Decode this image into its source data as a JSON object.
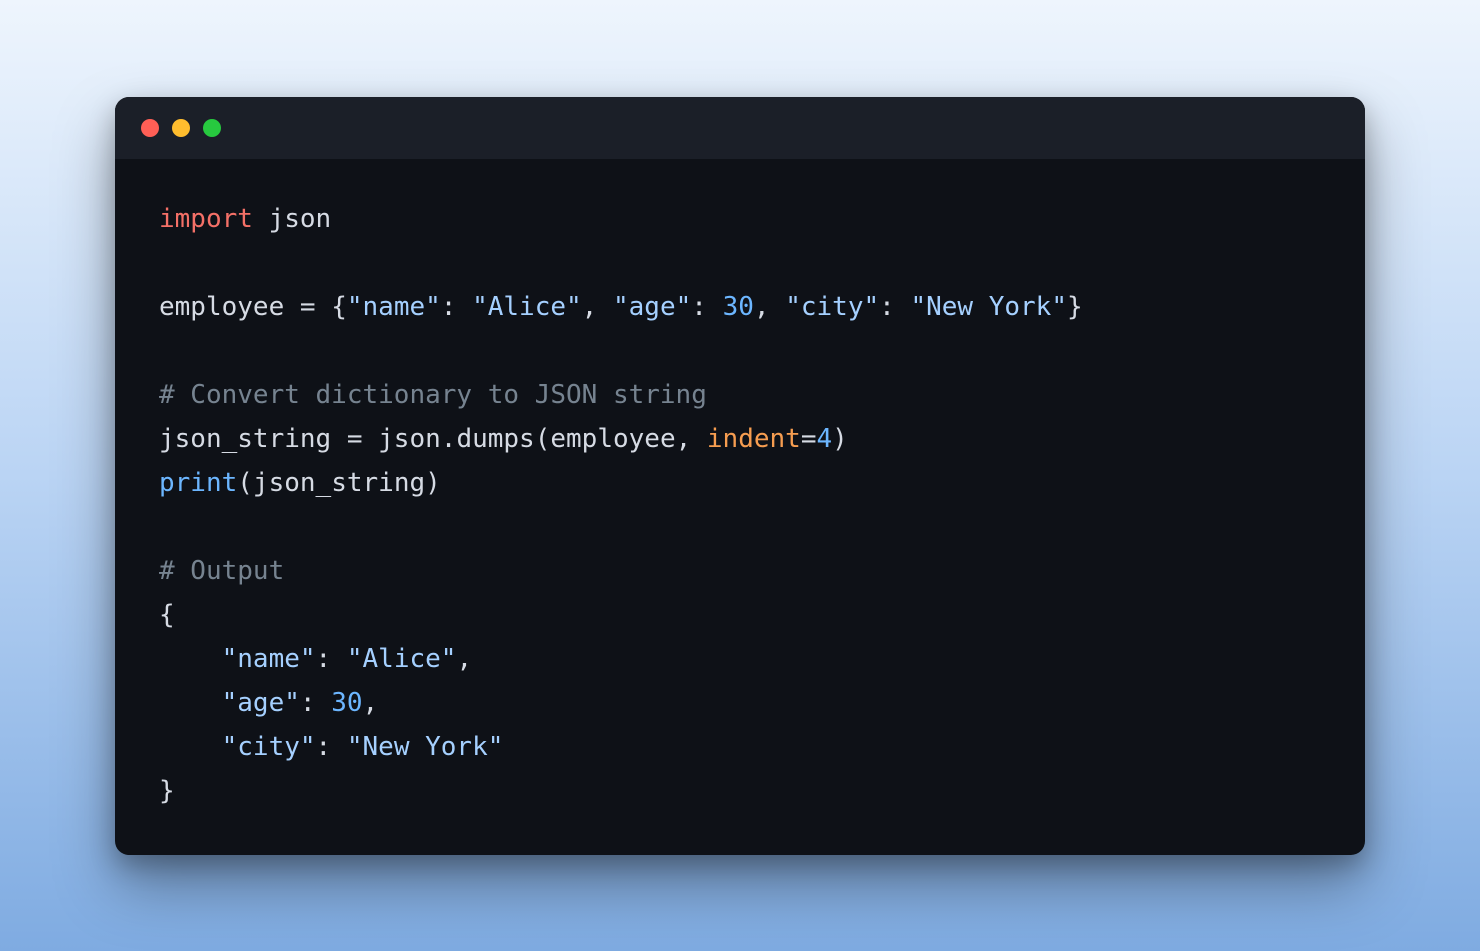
{
  "window": {
    "traffic_lights": [
      "red",
      "yellow",
      "green"
    ]
  },
  "code": {
    "lines": [
      [
        {
          "cls": "tok-kw",
          "t": "import"
        },
        {
          "cls": "tok-ident",
          "t": " json"
        }
      ],
      [],
      [
        {
          "cls": "tok-ident",
          "t": "employee "
        },
        {
          "cls": "tok-punct",
          "t": "= {"
        },
        {
          "cls": "tok-str",
          "t": "\"name\""
        },
        {
          "cls": "tok-punct",
          "t": ": "
        },
        {
          "cls": "tok-str",
          "t": "\"Alice\""
        },
        {
          "cls": "tok-punct",
          "t": ", "
        },
        {
          "cls": "tok-str",
          "t": "\"age\""
        },
        {
          "cls": "tok-punct",
          "t": ": "
        },
        {
          "cls": "tok-num",
          "t": "30"
        },
        {
          "cls": "tok-punct",
          "t": ", "
        },
        {
          "cls": "tok-str",
          "t": "\"city\""
        },
        {
          "cls": "tok-punct",
          "t": ": "
        },
        {
          "cls": "tok-str",
          "t": "\"New York\""
        },
        {
          "cls": "tok-punct",
          "t": "}"
        }
      ],
      [],
      [
        {
          "cls": "tok-comment",
          "t": "# Convert dictionary to JSON string"
        }
      ],
      [
        {
          "cls": "tok-ident",
          "t": "json_string "
        },
        {
          "cls": "tok-punct",
          "t": "= "
        },
        {
          "cls": "tok-ident",
          "t": "json"
        },
        {
          "cls": "tok-punct",
          "t": "."
        },
        {
          "cls": "tok-ident",
          "t": "dumps"
        },
        {
          "cls": "tok-punct",
          "t": "(employee, "
        },
        {
          "cls": "tok-param",
          "t": "indent"
        },
        {
          "cls": "tok-punct",
          "t": "="
        },
        {
          "cls": "tok-num",
          "t": "4"
        },
        {
          "cls": "tok-punct",
          "t": ")"
        }
      ],
      [
        {
          "cls": "tok-func",
          "t": "print"
        },
        {
          "cls": "tok-punct",
          "t": "(json_string)"
        }
      ],
      [],
      [
        {
          "cls": "tok-comment",
          "t": "# Output"
        }
      ],
      [
        {
          "cls": "tok-punct",
          "t": "{"
        }
      ],
      [
        {
          "cls": "tok-punct",
          "t": "    "
        },
        {
          "cls": "tok-str",
          "t": "\"name\""
        },
        {
          "cls": "tok-punct",
          "t": ": "
        },
        {
          "cls": "tok-str",
          "t": "\"Alice\""
        },
        {
          "cls": "tok-punct",
          "t": ","
        }
      ],
      [
        {
          "cls": "tok-punct",
          "t": "    "
        },
        {
          "cls": "tok-str",
          "t": "\"age\""
        },
        {
          "cls": "tok-punct",
          "t": ": "
        },
        {
          "cls": "tok-num",
          "t": "30"
        },
        {
          "cls": "tok-punct",
          "t": ","
        }
      ],
      [
        {
          "cls": "tok-punct",
          "t": "    "
        },
        {
          "cls": "tok-str",
          "t": "\"city\""
        },
        {
          "cls": "tok-punct",
          "t": ": "
        },
        {
          "cls": "tok-str",
          "t": "\"New York\""
        }
      ],
      [
        {
          "cls": "tok-punct",
          "t": "}"
        }
      ]
    ]
  }
}
